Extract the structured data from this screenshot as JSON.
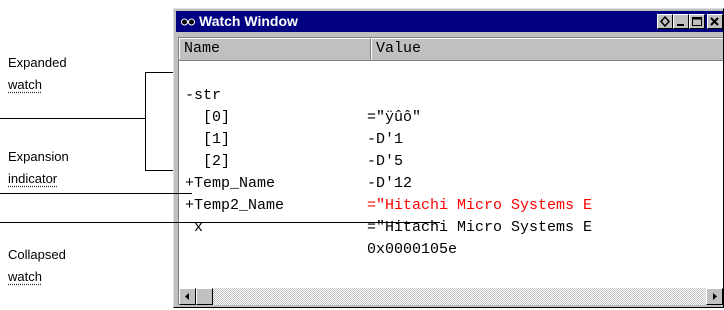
{
  "annotations": [
    {
      "line1": "Expanded",
      "line2": "watch"
    },
    {
      "line1": "Expansion",
      "line2": "indicator"
    },
    {
      "line1": "Collapsed",
      "line2": "watch"
    }
  ],
  "window": {
    "title": "Watch Window",
    "title_icon": "watch-glasses-icon",
    "columns": {
      "name": "Name",
      "value": "Value"
    },
    "rows": [
      {
        "name": "-str",
        "value": "=\"ÿûô\""
      },
      {
        "name": "  [0]",
        "value": "-D'1"
      },
      {
        "name": "  [1]",
        "value": "-D'5"
      },
      {
        "name": "  [2]",
        "value": "-D'12"
      },
      {
        "name": "+Temp_Name",
        "value": "=\"Hitachi Micro Systems E",
        "changed": true
      },
      {
        "name": "+Temp2_Name",
        "value": "=\"Hitachi Micro Systems E"
      },
      {
        "name": " x",
        "value": "0x0000105e"
      }
    ],
    "colors": {
      "titlebar": "#000080",
      "changed_value": "#ff0000",
      "face": "#c0c0c0"
    }
  }
}
